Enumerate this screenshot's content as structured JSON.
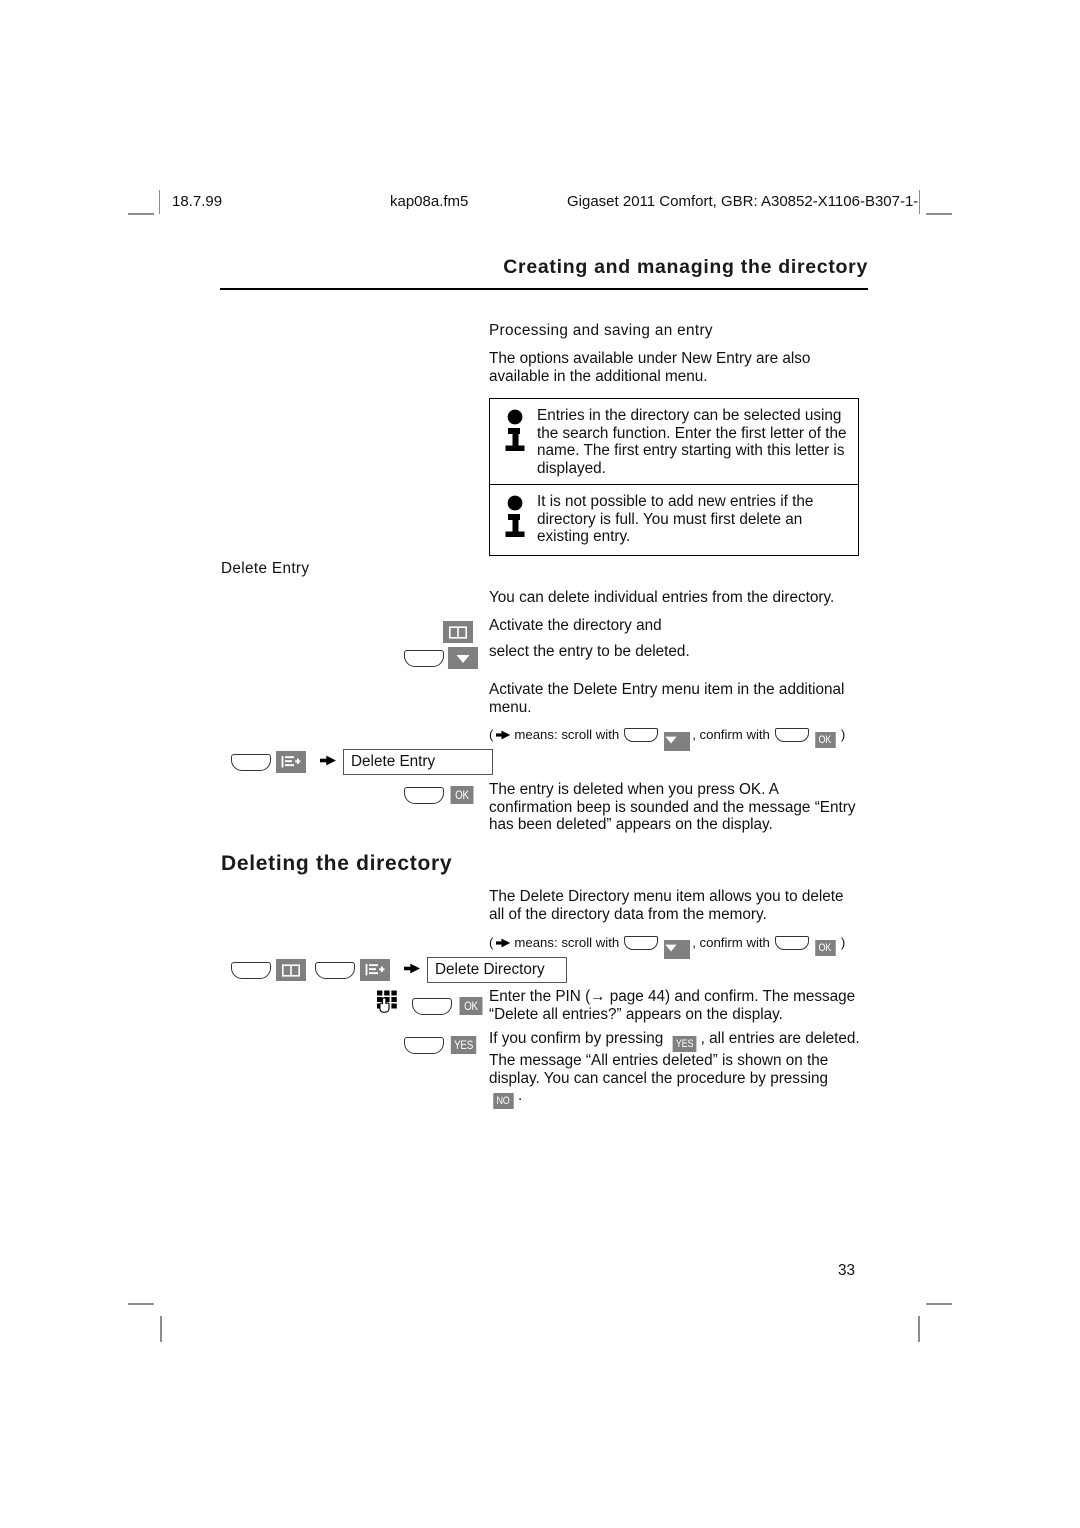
{
  "print_header": {
    "date": "18.7.99",
    "file": "kap08a.fm5",
    "document": "Gigaset 2011 Comfort, GBR: A30852-X1106-B307-1-"
  },
  "running_head": "Creating and managing the directory",
  "sections": {
    "processing": {
      "heading": "Processing and saving an entry",
      "paragraph": "The options available under New Entry are also available in the additional menu."
    },
    "info_boxes": [
      {
        "icon": "info-icon",
        "text": "Entries in the directory can be selected using the search function. Enter the first letter of the name. The first entry starting with this letter is displayed."
      },
      {
        "icon": "info-icon",
        "text": "It is not possible to add new entries if the directory is full. You must first delete an existing entry."
      }
    ],
    "delete_entry": {
      "heading": "Delete Entry",
      "intro": "You can delete individual entries from the directory.",
      "step_directory": "Activate the directory and",
      "step_select": "select the entry to be deleted.",
      "step_menu": "Activate the Delete Entry menu item in the additional menu.",
      "note_prefix": "(",
      "note_means": "means: scroll with",
      "note_confirm": ", confirm with",
      "note_suffix": ")",
      "menu_item": "Delete Entry",
      "result": "The entry is deleted when you press OK. A confirmation beep is sounded and the message “Entry has been deleted” appears on the display."
    },
    "deleting_directory": {
      "heading": "Deleting the directory",
      "intro": "The Delete Directory menu item allows you to delete all of the directory data from the memory.",
      "note_prefix": "(",
      "note_means": "means: scroll with",
      "note_confirm": ", confirm with",
      "note_suffix": ")",
      "menu_item": "Delete Directory",
      "pin_step_a": "Enter the PIN (",
      "pin_step_b": " page 44) and confirm. The message “Delete all entries?” appears on the display.",
      "confirm_a": "If you confirm by pressing ",
      "confirm_b": ", all entries are deleted. The message “All entries deleted” is shown on the display. You can cancel the procedure by pressing ",
      "confirm_c": "."
    }
  },
  "keys": {
    "ok": "OK",
    "yes": "YES",
    "no": "NO"
  },
  "icons": {
    "directory": "book-icon",
    "down": "down-arrow-icon",
    "menu_plus": "additional-menu-icon",
    "keypad": "keypad-icon",
    "scroll_arrow": "scroll-arrow-icon"
  },
  "page_number": "33",
  "colors": {
    "gray_key": "#808080",
    "text": "#111111",
    "rule": "#000000",
    "cropmark": "#8c8c8c"
  }
}
